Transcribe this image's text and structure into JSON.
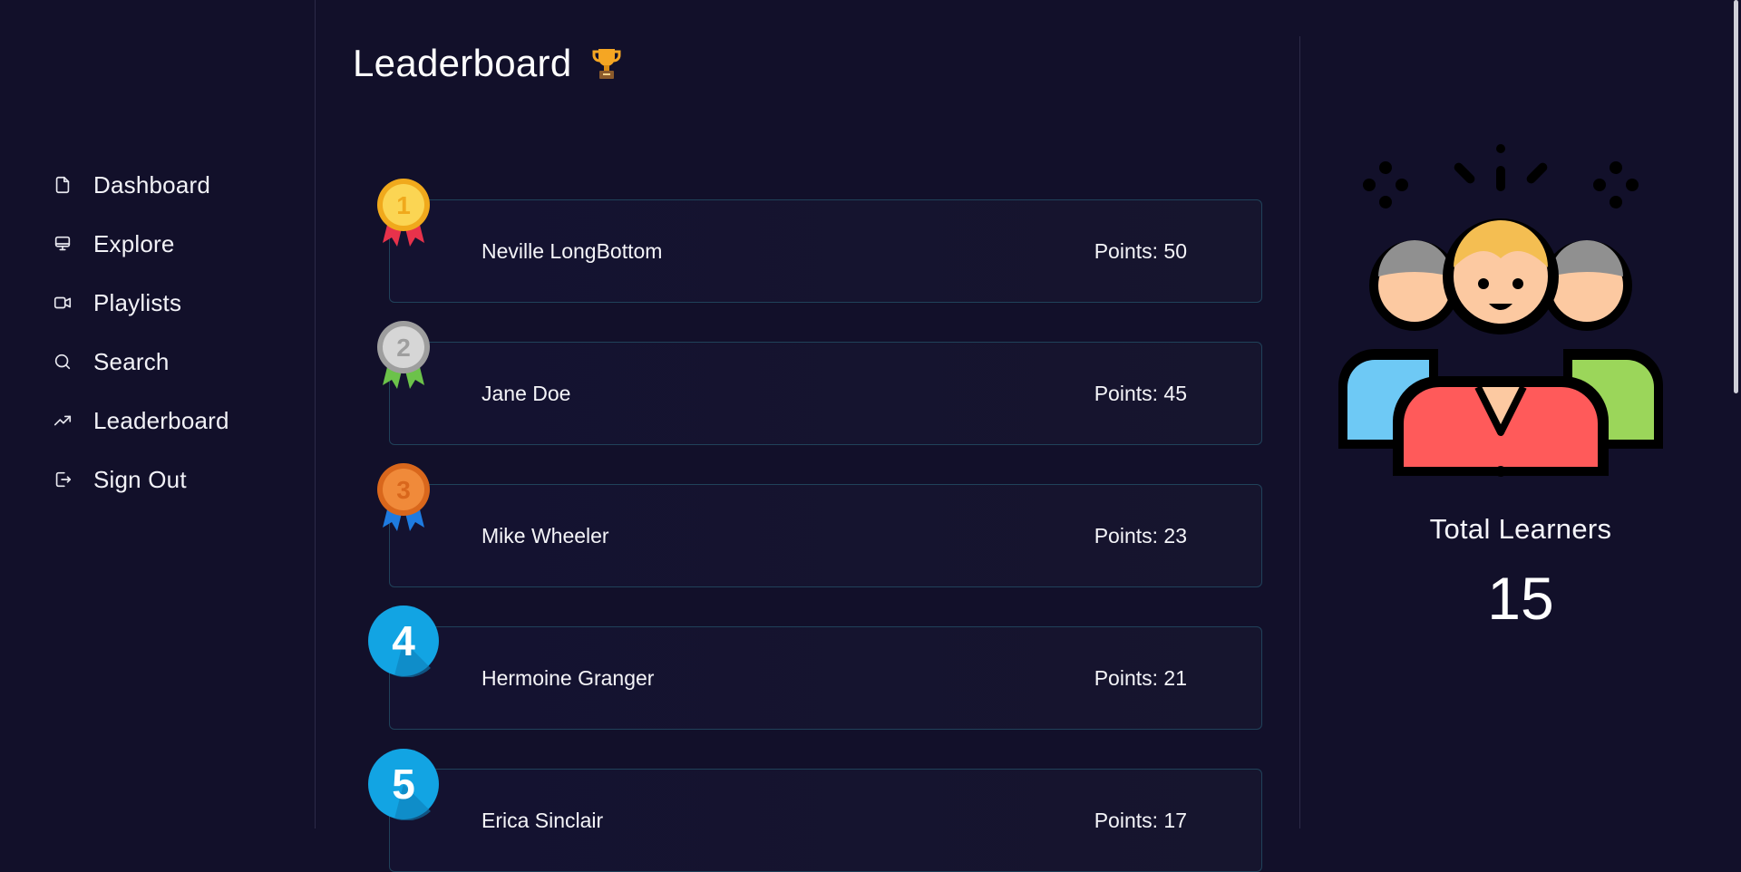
{
  "sidebar": {
    "items": [
      {
        "label": "Dashboard",
        "icon": "file-icon"
      },
      {
        "label": "Explore",
        "icon": "monitor-icon"
      },
      {
        "label": "Playlists",
        "icon": "video-icon"
      },
      {
        "label": "Search",
        "icon": "search-icon"
      },
      {
        "label": "Leaderboard",
        "icon": "trending-up-icon"
      },
      {
        "label": "Sign Out",
        "icon": "sign-out-icon"
      }
    ]
  },
  "main": {
    "title": "Leaderboard",
    "title_icon": "trophy-icon",
    "leaderboard": [
      {
        "rank": "1",
        "name": "Neville LongBottom",
        "points": "Points: 50",
        "badge": "gold-medal-icon"
      },
      {
        "rank": "2",
        "name": "Jane Doe",
        "points": "Points: 45",
        "badge": "silver-medal-icon"
      },
      {
        "rank": "3",
        "name": "Mike Wheeler",
        "points": "Points: 23",
        "badge": "bronze-medal-icon"
      },
      {
        "rank": "4",
        "name": "Hermoine Granger",
        "points": "Points: 21",
        "badge": "rank-4-icon"
      },
      {
        "rank": "5",
        "name": "Erica Sinclair",
        "points": "Points: 17",
        "badge": "rank-5-icon"
      }
    ]
  },
  "stats": {
    "illustration": "learners-group-icon",
    "label": "Total Learners",
    "value": "15"
  },
  "colors": {
    "background": "#12102a",
    "row_border": "#20425a",
    "gold": "#f7c53f",
    "silver": "#bdbdbd",
    "bronze": "#e07a2e",
    "blue_badge": "#0fa3e0"
  }
}
